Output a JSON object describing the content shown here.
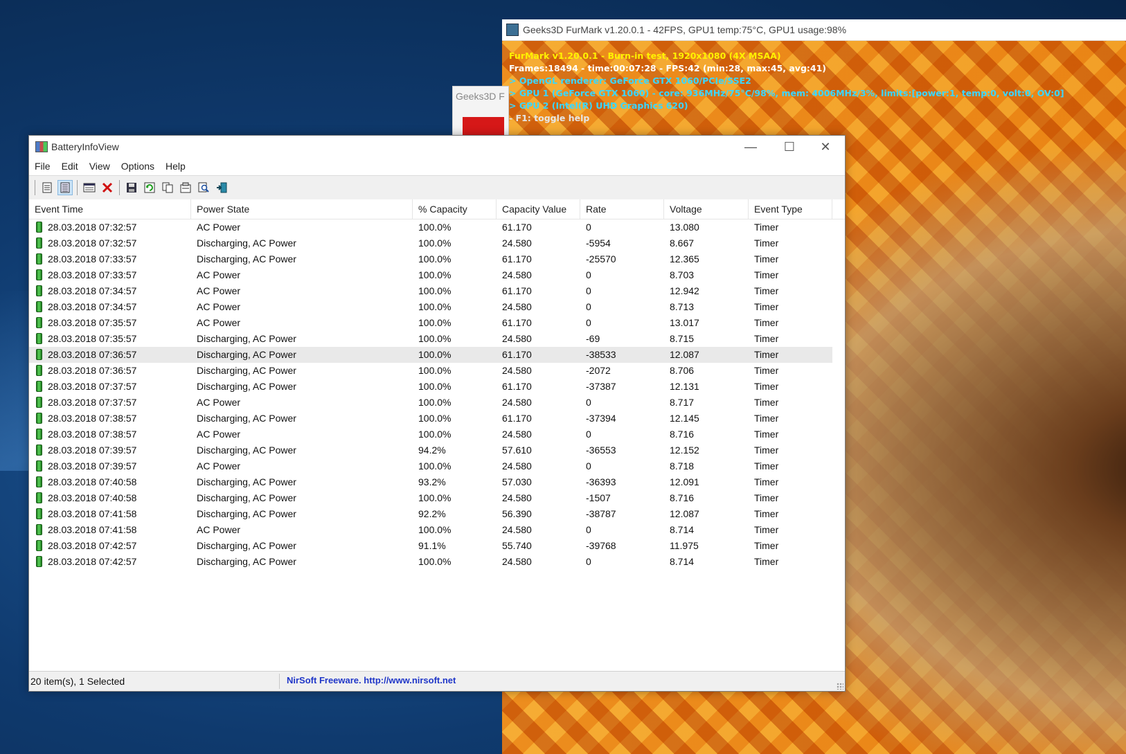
{
  "furmark": {
    "title": "Geeks3D FurMark v1.20.0.1 - 42FPS, GPU1 temp:75°C, GPU1 usage:98%",
    "hud": {
      "line1": "FurMark v1.20.0.1 - Burn-in test, 1920x1080 (4X MSAA)",
      "line2": "Frames:18494 - time:00:07:28 - FPS:42 (min:28, max:45, avg:41)",
      "line3": "> OpenGL renderer: GeForce GTX 1060/PCIe/SSE2",
      "line4": "> GPU 1 (GeForce GTX 1060) - core: 936MHz/75°C/98%, mem: 4006MHz/3%, limits:[power:1, temp:0, volt:0, OV:0]",
      "line5": "> GPU 2 (Intel(R) UHD Graphics 620)",
      "line6": "- F1: toggle help"
    }
  },
  "geeks_small": {
    "title": "Geeks3D F"
  },
  "app": {
    "title": "BatteryInfoView",
    "window_controls": {
      "minimize": "—",
      "maximize": "☐",
      "close": "✕"
    },
    "menu": [
      "File",
      "Edit",
      "View",
      "Options",
      "Help"
    ],
    "toolbar_icons": [
      "list-icon",
      "details-icon",
      "window-icon",
      "delete-icon",
      "save-icon",
      "refresh-icon",
      "copy-icon",
      "properties-icon",
      "find-icon",
      "exit-icon"
    ],
    "columns": [
      "Event Time",
      "Power State",
      "% Capacity",
      "Capacity Value",
      "Rate",
      "Voltage",
      "Event Type"
    ],
    "rows": [
      [
        "28.03.2018 07:32:57",
        "AC Power",
        "100.0%",
        "61.170",
        "0",
        "13.080",
        "Timer"
      ],
      [
        "28.03.2018 07:32:57",
        "Discharging, AC Power",
        "100.0%",
        "24.580",
        "-5954",
        "8.667",
        "Timer"
      ],
      [
        "28.03.2018 07:33:57",
        "Discharging, AC Power",
        "100.0%",
        "61.170",
        "-25570",
        "12.365",
        "Timer"
      ],
      [
        "28.03.2018 07:33:57",
        "AC Power",
        "100.0%",
        "24.580",
        "0",
        "8.703",
        "Timer"
      ],
      [
        "28.03.2018 07:34:57",
        "AC Power",
        "100.0%",
        "61.170",
        "0",
        "12.942",
        "Timer"
      ],
      [
        "28.03.2018 07:34:57",
        "AC Power",
        "100.0%",
        "24.580",
        "0",
        "8.713",
        "Timer"
      ],
      [
        "28.03.2018 07:35:57",
        "AC Power",
        "100.0%",
        "61.170",
        "0",
        "13.017",
        "Timer"
      ],
      [
        "28.03.2018 07:35:57",
        "Discharging, AC Power",
        "100.0%",
        "24.580",
        "-69",
        "8.715",
        "Timer"
      ],
      [
        "28.03.2018 07:36:57",
        "Discharging, AC Power",
        "100.0%",
        "61.170",
        "-38533",
        "12.087",
        "Timer"
      ],
      [
        "28.03.2018 07:36:57",
        "Discharging, AC Power",
        "100.0%",
        "24.580",
        "-2072",
        "8.706",
        "Timer"
      ],
      [
        "28.03.2018 07:37:57",
        "Discharging, AC Power",
        "100.0%",
        "61.170",
        "-37387",
        "12.131",
        "Timer"
      ],
      [
        "28.03.2018 07:37:57",
        "AC Power",
        "100.0%",
        "24.580",
        "0",
        "8.717",
        "Timer"
      ],
      [
        "28.03.2018 07:38:57",
        "Discharging, AC Power",
        "100.0%",
        "61.170",
        "-37394",
        "12.145",
        "Timer"
      ],
      [
        "28.03.2018 07:38:57",
        "AC Power",
        "100.0%",
        "24.580",
        "0",
        "8.716",
        "Timer"
      ],
      [
        "28.03.2018 07:39:57",
        "Discharging, AC Power",
        "94.2%",
        "57.610",
        "-36553",
        "12.152",
        "Timer"
      ],
      [
        "28.03.2018 07:39:57",
        "AC Power",
        "100.0%",
        "24.580",
        "0",
        "8.718",
        "Timer"
      ],
      [
        "28.03.2018 07:40:58",
        "Discharging, AC Power",
        "93.2%",
        "57.030",
        "-36393",
        "12.091",
        "Timer"
      ],
      [
        "28.03.2018 07:40:58",
        "Discharging, AC Power",
        "100.0%",
        "24.580",
        "-1507",
        "8.716",
        "Timer"
      ],
      [
        "28.03.2018 07:41:58",
        "Discharging, AC Power",
        "92.2%",
        "56.390",
        "-38787",
        "12.087",
        "Timer"
      ],
      [
        "28.03.2018 07:41:58",
        "AC Power",
        "100.0%",
        "24.580",
        "0",
        "8.714",
        "Timer"
      ],
      [
        "28.03.2018 07:42:57",
        "Discharging, AC Power",
        "91.1%",
        "55.740",
        "-39768",
        "11.975",
        "Timer"
      ],
      [
        "28.03.2018 07:42:57",
        "Discharging, AC Power",
        "100.0%",
        "24.580",
        "0",
        "8.714",
        "Timer"
      ]
    ],
    "selected_row": 8,
    "status": {
      "count": "20 item(s), 1 Selected",
      "credit": "NirSoft Freeware.  http://www.nirsoft.net"
    }
  }
}
